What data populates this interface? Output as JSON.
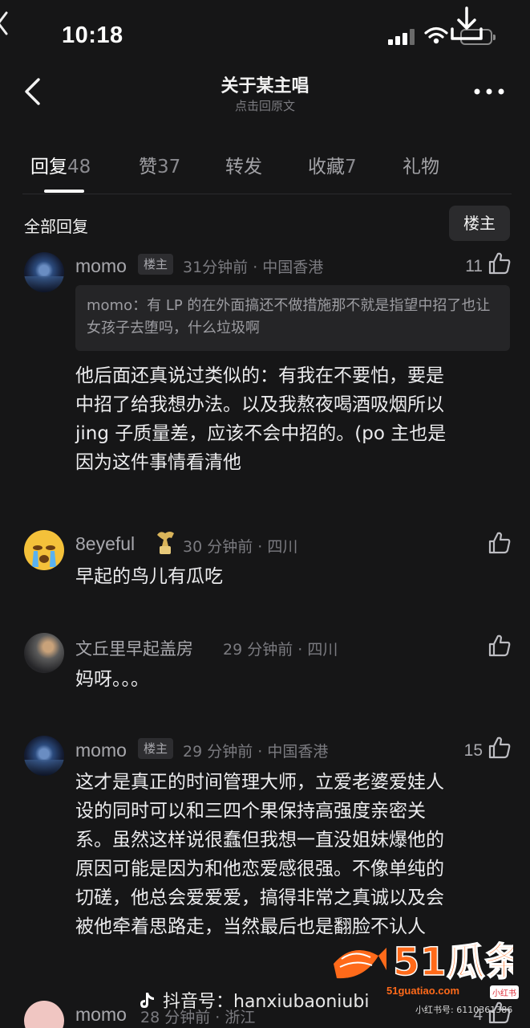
{
  "status": {
    "time": "10:18",
    "signal_icon": "signal-icon",
    "wifi_icon": "wifi-icon",
    "battery_icon": "battery-icon",
    "download_icon": "download-icon"
  },
  "nav": {
    "title": "关于某主唱",
    "subtitle": "点击回原文",
    "back_icon": "chevron-left-icon",
    "more_icon": "more-dots-icon"
  },
  "tabs": [
    {
      "label": "回复",
      "count": "48",
      "active": true
    },
    {
      "label": "赞",
      "count": "37"
    },
    {
      "label": "转发",
      "count": ""
    },
    {
      "label": "收藏",
      "count": "7"
    },
    {
      "label": "礼物",
      "count": ""
    }
  ],
  "section": {
    "title": "全部回复",
    "filter": "楼主"
  },
  "comments": [
    {
      "user": "momo",
      "tag": "楼主",
      "meta": "31分钟前 · 中国香港",
      "likes": "11",
      "quote": "momo：有 LP 的在外面搞还不做措施那不就是指望中招了也让女孩子去堕吗，什么垃圾啊",
      "lines": [
        "他后面还真说过类似的：有我在不要怕，要是",
        "中招了给我想办法。以及我熬夜喝酒吸烟所以",
        "jing 子质量差，应该不会中招的。(po 主也是",
        "因为这件事情看清他"
      ]
    },
    {
      "user": "8eyeful",
      "meta": "30 分钟前 · 四川",
      "likes": "",
      "lines": [
        "早起的鸟儿有瓜吃"
      ]
    },
    {
      "user": "文丘里早起盖房",
      "meta": "29 分钟前 · 四川",
      "likes": "",
      "lines": [
        "妈呀。。。"
      ]
    },
    {
      "user": "momo",
      "tag": "楼主",
      "meta": "29 分钟前 · 中国香港",
      "likes": "15",
      "lines": [
        "这才是真正的时间管理大师，立爱老婆爱娃人",
        "设的同时可以和三四个果保持高强度亲密关",
        "系。虽然这样说很蠢但我想一直没姐妹爆他的",
        "原因可能是因为和他恋爱感很强。不像单纯的",
        "切磋，他总会爱爱爱，搞得非常之真诚以及会",
        "被他牵着思路走，当然最后也是翻脸不认人"
      ]
    },
    {
      "user": "momo",
      "meta": "28 分钟前 · 浙江",
      "likes": "4"
    }
  ],
  "watermark": {
    "douyin": "抖音号：hanxiubaoniubi",
    "logo_text": "51瓜条",
    "url": "51guatiao.com",
    "xhs_badge": "小红书",
    "xhs_id": "小红书号: 6110361386"
  }
}
